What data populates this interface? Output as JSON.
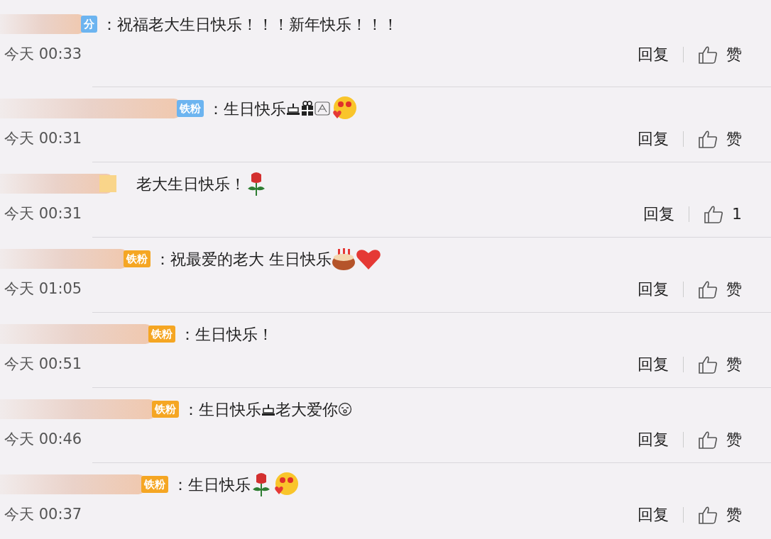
{
  "comments": [
    {
      "badge": {
        "text": "分",
        "color": "#6cb4f0"
      },
      "text": "：祝福老大生日快乐！！！新年快乐！！！",
      "time": "今天 00:33",
      "reply": "回复",
      "like": "赞"
    },
    {
      "badge": {
        "text": "铁粉",
        "color": "#6cb4f0"
      },
      "text": "：生日快乐",
      "emojis": [
        {
          "kind": "cake"
        },
        {
          "kind": "gift"
        },
        {
          "kind": "sketch"
        },
        {
          "kind": "heart-face"
        }
      ],
      "time": "今天 00:31",
      "reply": "回复",
      "like": "赞"
    },
    {
      "text": "老大生日快乐！",
      "emojis": [
        {
          "kind": "rose"
        }
      ],
      "time": "今天 00:31",
      "reply": "回复",
      "like": "1"
    },
    {
      "badge": {
        "text": "铁粉",
        "color": "#f5a623"
      },
      "text": "：祝最爱的老大 生日快乐",
      "emojis": [
        {
          "kind": "birthday-cake"
        },
        {
          "kind": "heart"
        }
      ],
      "time": "今天 01:05",
      "reply": "回复",
      "like": "赞"
    },
    {
      "badge": {
        "text": "铁粉",
        "color": "#f5a623"
      },
      "text": "：生日快乐！",
      "time": "今天 00:51",
      "reply": "回复",
      "like": "赞"
    },
    {
      "badge": {
        "text": "铁粉",
        "color": "#f5a623"
      },
      "text": "：生日快乐",
      "emojis": [
        {
          "kind": "cake"
        }
      ],
      "text2": "老大爱你",
      "emojis2": [
        {
          "kind": "surprised-face"
        }
      ],
      "time": "今天 00:46",
      "reply": "回复",
      "like": "赞"
    },
    {
      "badge": {
        "text": "铁粉",
        "color": "#f5a623"
      },
      "text": "：生日快乐",
      "emojis": [
        {
          "kind": "rose"
        },
        {
          "kind": "heart-face"
        }
      ],
      "time": "今天 00:37",
      "reply": "回复",
      "like": "赞"
    }
  ]
}
